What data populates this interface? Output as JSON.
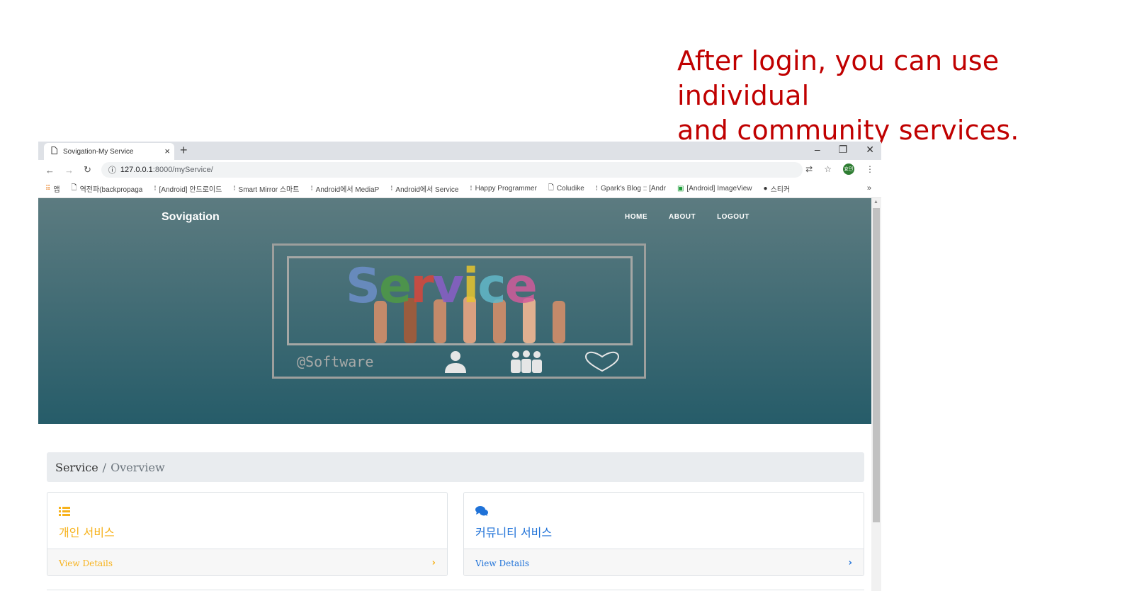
{
  "caption": {
    "line1": "After login, you can use individual",
    "line2": "and community services."
  },
  "browser": {
    "tab_title": "Sovigation-My Service",
    "new_tab": "+",
    "url_host": "127.0.0.1",
    "url_path": ":8000/myService/",
    "avatar_text": "효민",
    "bookmarks": [
      {
        "label": "앱",
        "icon": "apps-grid-icon"
      },
      {
        "label": "역전파(backpropaga",
        "icon": "page-icon"
      },
      {
        "label": "[Android] 안드로이드",
        "icon": "tistory-icon"
      },
      {
        "label": "Smart Mirror 스마트",
        "icon": "tistory-icon"
      },
      {
        "label": "Android에서 MediaP",
        "icon": "tistory-icon"
      },
      {
        "label": "Android에서 Service",
        "icon": "tistory-icon"
      },
      {
        "label": "Happy Programmer",
        "icon": "tistory-icon"
      },
      {
        "label": "Coludike",
        "icon": "page-icon"
      },
      {
        "label": "Gpark's Blog :: [Andr",
        "icon": "tistory-icon"
      },
      {
        "label": "[Android] ImageView",
        "icon": "image-icon"
      },
      {
        "label": "스티커",
        "icon": "github-icon"
      }
    ],
    "bookmarks_more": "»"
  },
  "site": {
    "brand": "Sovigation",
    "nav": [
      "HOME",
      "ABOUT",
      "LOGOUT"
    ],
    "hero_word": [
      "S",
      "e",
      "r",
      "v",
      "i",
      "c",
      "e"
    ],
    "hero_word_colors": [
      "#6d8fc9",
      "#4f9a45",
      "#d9463b",
      "#8a5ec8",
      "#e7c52f",
      "#62b8c9",
      "#d05c9b"
    ],
    "hero_tagline": "@Software"
  },
  "breadcrumb": {
    "current": "Service",
    "separator": "/",
    "section": "Overview"
  },
  "cards": [
    {
      "icon": "list-icon",
      "title": "개인 서비스",
      "link": "View Details",
      "chevron": "›",
      "color": "#f7b21b"
    },
    {
      "icon": "comments-icon",
      "title": "커뮤니티 서비스",
      "link": "View Details",
      "chevron": "›",
      "color": "#1f72d8"
    }
  ]
}
